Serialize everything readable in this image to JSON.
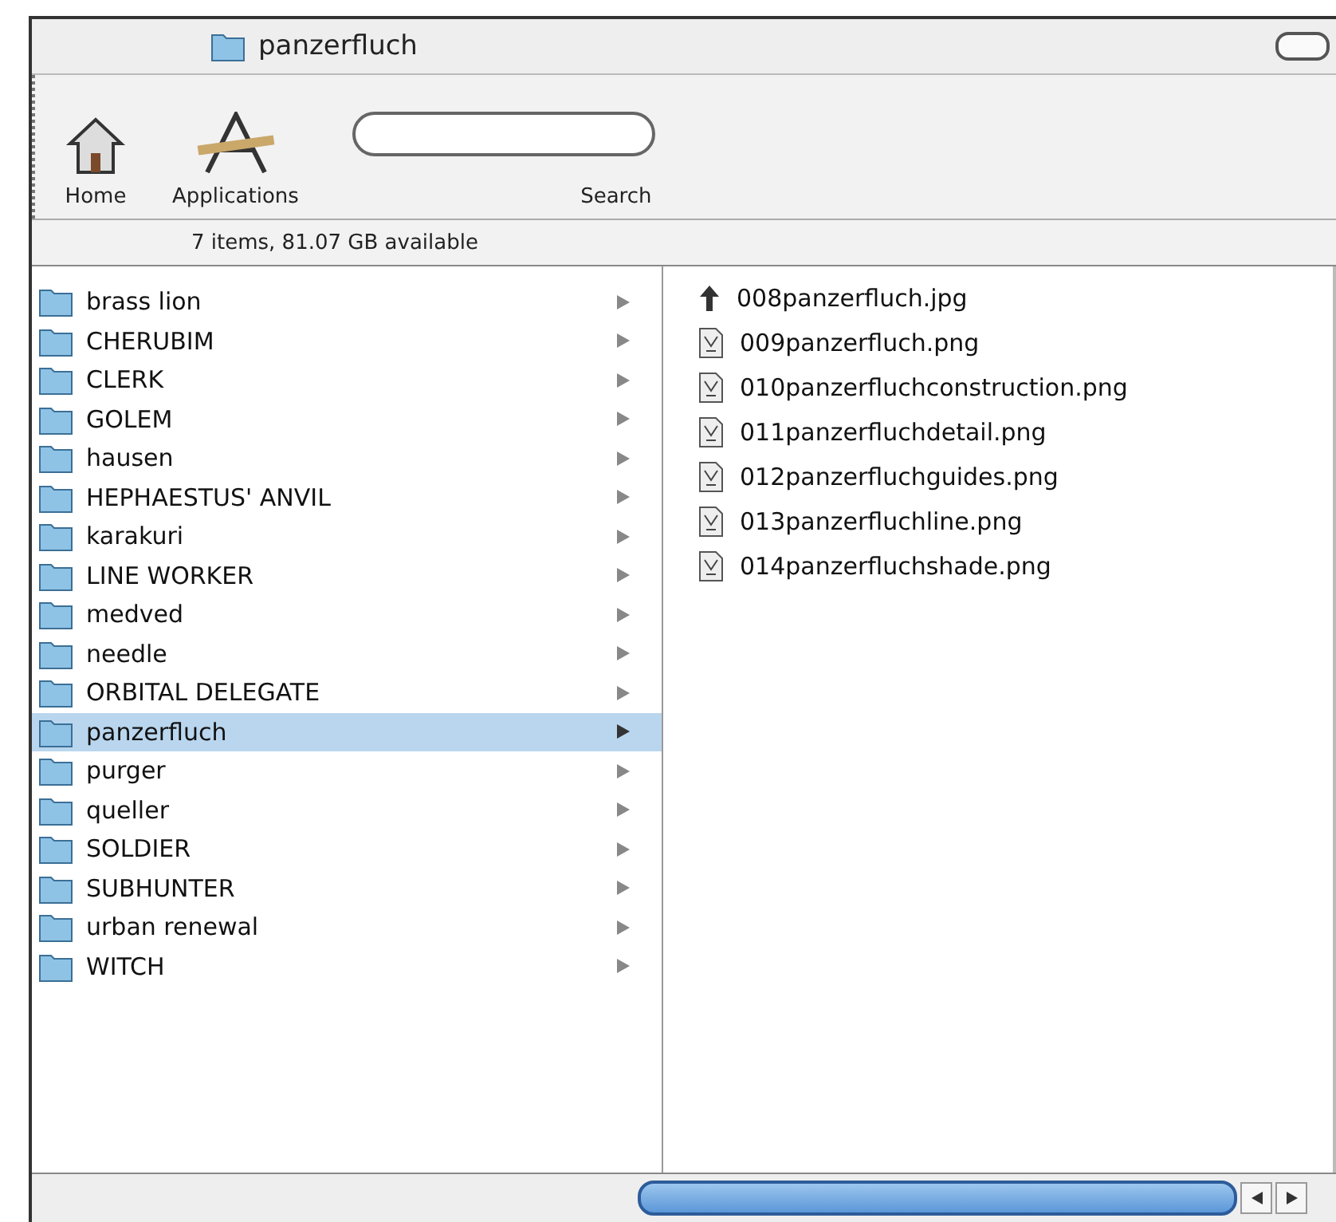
{
  "window": {
    "title": "panzerfluch"
  },
  "toolbar": {
    "items": [
      {
        "kind": "home",
        "label": "Home"
      },
      {
        "kind": "applications",
        "label": "Applications"
      }
    ],
    "search": {
      "label": "Search"
    }
  },
  "status_bar": "7 items, 81.07 GB available",
  "folders": [
    {
      "name": "brass lion",
      "selected": false
    },
    {
      "name": "CHERUBIM",
      "selected": false
    },
    {
      "name": "CLERK",
      "selected": false
    },
    {
      "name": "GOLEM",
      "selected": false
    },
    {
      "name": "hausen",
      "selected": false
    },
    {
      "name": "HEPHAESTUS' ANVIL",
      "selected": false
    },
    {
      "name": "karakuri",
      "selected": false
    },
    {
      "name": "LINE WORKER",
      "selected": false
    },
    {
      "name": "medved",
      "selected": false
    },
    {
      "name": "needle",
      "selected": false
    },
    {
      "name": "ORBITAL DELEGATE",
      "selected": false
    },
    {
      "name": "panzerfluch",
      "selected": true
    },
    {
      "name": "purger",
      "selected": false
    },
    {
      "name": "queller",
      "selected": false
    },
    {
      "name": "SOLDIER",
      "selected": false
    },
    {
      "name": "SUBHUNTER",
      "selected": false
    },
    {
      "name": "urban renewal",
      "selected": false
    },
    {
      "name": "WITCH",
      "selected": false
    }
  ],
  "files": [
    {
      "name": "008panzerfluch.jpg",
      "kind": "alias"
    },
    {
      "name": "009panzerfluch.png",
      "kind": "image"
    },
    {
      "name": "010panzerfluchconstruction.png",
      "kind": "image"
    },
    {
      "name": "011panzerfluchdetail.png",
      "kind": "image"
    },
    {
      "name": "012panzerfluchguides.png",
      "kind": "image"
    },
    {
      "name": "013panzerfluchline.png",
      "kind": "image"
    },
    {
      "name": "014panzerfluchshade.png",
      "kind": "image"
    }
  ]
}
